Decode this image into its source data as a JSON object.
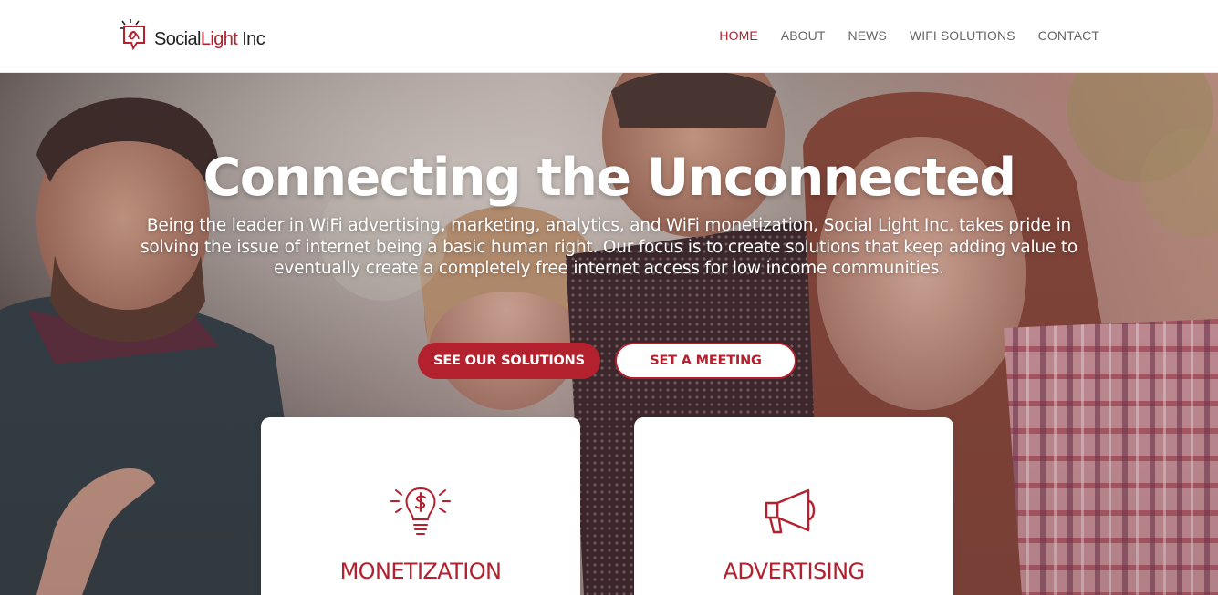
{
  "brand": {
    "name_part1": "Social",
    "name_part2": "Light",
    "name_part3": "Inc"
  },
  "nav": {
    "items": [
      {
        "label": "HOME",
        "active": true
      },
      {
        "label": "ABOUT",
        "active": false
      },
      {
        "label": "NEWS",
        "active": false
      },
      {
        "label": "WIFI SOLUTIONS",
        "active": false
      },
      {
        "label": "CONTACT",
        "active": false
      }
    ]
  },
  "hero": {
    "title": "Connecting the Unconnected",
    "subtitle_lines": [
      "Being the leader in WiFi advertising, marketing, analytics, and WiFi monetization, Social Light Inc. takes pride in",
      "solving the issue of internet being a basic human right. Our focus is to create solutions that keep adding value to",
      "eventually create a completely free internet access for low income communities."
    ],
    "primary_button": "SEE OUR SOLUTIONS",
    "secondary_button": "SET A MEETING"
  },
  "cards": [
    {
      "title": "MONETIZATION",
      "icon": "lightbulb-dollar-icon"
    },
    {
      "title": "ADVERTISING",
      "icon": "megaphone-icon"
    }
  ],
  "colors": {
    "accent": "#b3202e",
    "nav_text": "#666666",
    "white": "#ffffff"
  }
}
